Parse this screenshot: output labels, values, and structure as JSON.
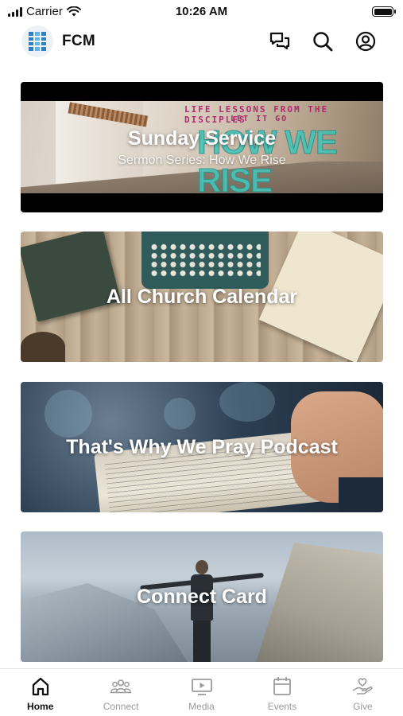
{
  "status_bar": {
    "carrier": "Carrier",
    "time": "10:26 AM"
  },
  "header": {
    "title": "FCM",
    "icons": [
      "chat-icon",
      "search-icon",
      "profile-icon"
    ]
  },
  "cards": [
    {
      "title": "Sunday Service",
      "subtitle": "Sermon Series: How We Rise",
      "image_text": {
        "line1": "LIFE LESSONS FROM THE DISCIPLES",
        "line2": "LET IT GO",
        "headline": "HOW WE RISE"
      }
    },
    {
      "title": "All Church Calendar"
    },
    {
      "title": "That's Why We Pray Podcast"
    },
    {
      "title": "Connect Card"
    }
  ],
  "tabs": [
    {
      "label": "Home",
      "icon": "home-icon",
      "active": true
    },
    {
      "label": "Connect",
      "icon": "group-icon",
      "active": false
    },
    {
      "label": "Media",
      "icon": "media-icon",
      "active": false
    },
    {
      "label": "Events",
      "icon": "calendar-icon",
      "active": false
    },
    {
      "label": "Give",
      "icon": "give-hand-heart-icon",
      "active": false
    }
  ],
  "colors": {
    "active_tab": "#111111",
    "inactive_tab": "#9b9b9b",
    "series_magenta": "#b3286f",
    "series_teal": "#46c4b8"
  }
}
